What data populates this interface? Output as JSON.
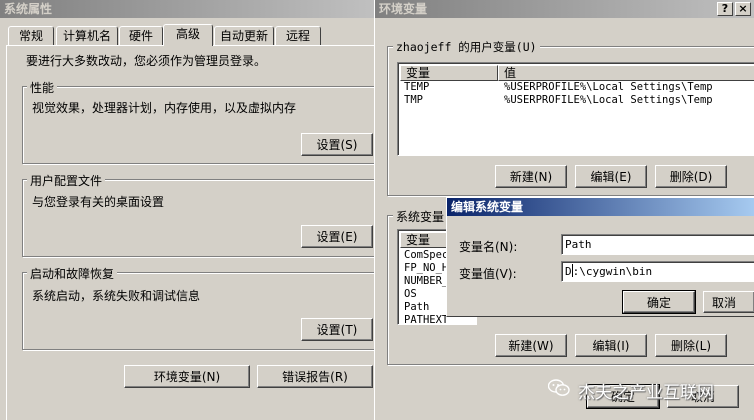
{
  "system_properties": {
    "title": "系统属性",
    "tabs": [
      {
        "label": "常规"
      },
      {
        "label": "计算机名"
      },
      {
        "label": "硬件"
      },
      {
        "label": "高级"
      },
      {
        "label": "自动更新"
      },
      {
        "label": "远程"
      }
    ],
    "notice": "要进行大多数改动，您必须作为管理员登录。",
    "performance": {
      "title": "性能",
      "desc": "视觉效果，处理器计划，内存使用，以及虚拟内存",
      "button": "设置(S)"
    },
    "user_profiles": {
      "title": "用户配置文件",
      "desc": "与您登录有关的桌面设置",
      "button": "设置(E)"
    },
    "startup_recovery": {
      "title": "启动和故障恢复",
      "desc": "系统启动，系统失败和调试信息",
      "button": "设置(T)"
    },
    "env_vars_button": "环境变量(N)",
    "error_report_button": "错误报告(R)"
  },
  "env_vars": {
    "title": "环境变量",
    "help_button": "?",
    "close_button": "×",
    "user_group_label": "zhaojeff 的用户变量(U)",
    "col_var": "变量",
    "col_val": "值",
    "user_vars": [
      {
        "name": "TEMP",
        "value": "%USERPROFILE%\\Local Settings\\Temp"
      },
      {
        "name": "TMP",
        "value": "%USERPROFILE%\\Local Settings\\Temp"
      }
    ],
    "user_new": "新建(N)",
    "user_edit": "编辑(E)",
    "user_delete": "删除(D)",
    "system_group_label": "系统变量",
    "system_vars": [
      {
        "name": "ComSpec"
      },
      {
        "name": "FP_NO_H"
      },
      {
        "name": "NUMBER_"
      },
      {
        "name": "OS"
      },
      {
        "name": "Path"
      },
      {
        "name": "PATHEXT"
      }
    ],
    "sys_new": "新建(W)",
    "sys_edit": "编辑(I)",
    "sys_delete": "删除(L)",
    "ok_button": "确定",
    "cancel_button": "取消"
  },
  "edit_dialog": {
    "title": "编辑系统变量",
    "name_label": "变量名(N):",
    "name_value": "Path",
    "value_label": "变量值(V):",
    "value_value": "D:\\cygwin\\bin",
    "ok_button": "确定",
    "cancel_button": "取消"
  },
  "watermark": {
    "text": "杰夫之产业互联网"
  }
}
